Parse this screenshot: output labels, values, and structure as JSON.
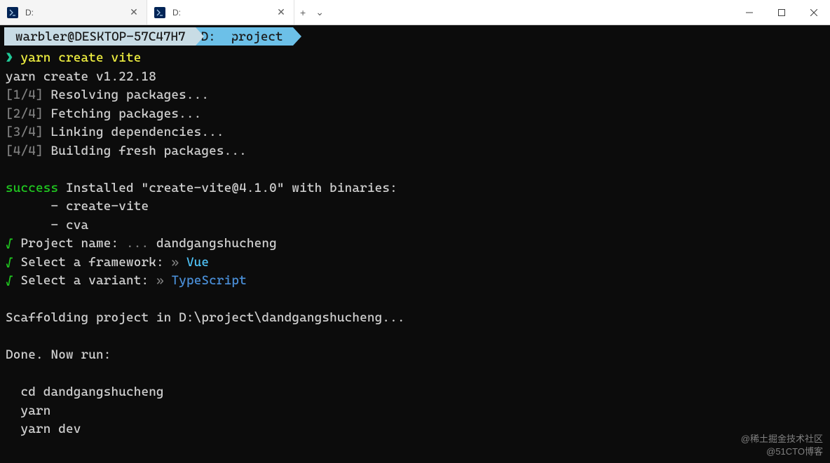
{
  "titlebar": {
    "tabs": [
      {
        "title": "D:",
        "active": false
      },
      {
        "title": "D:",
        "active": true
      }
    ],
    "new_tab": "+",
    "dropdown": "⌄"
  },
  "pathbar": {
    "user": "warbler@DESKTOP-57C47H7",
    "drive": "D:",
    "folder": "project"
  },
  "terminal": {
    "prompt_symbol": "❯",
    "command": "yarn create vite",
    "version_line": "yarn create v1.22.18",
    "steps": [
      {
        "num": "[1/4]",
        "text": "Resolving packages..."
      },
      {
        "num": "[2/4]",
        "text": "Fetching packages..."
      },
      {
        "num": "[3/4]",
        "text": "Linking dependencies..."
      },
      {
        "num": "[4/4]",
        "text": "Building fresh packages..."
      }
    ],
    "success_label": "success",
    "success_text": " Installed \"create-vite@4.1.0\" with binaries:",
    "binaries": [
      "      - create-vite",
      "      - cva"
    ],
    "project_name_check": "√",
    "project_name_label": " Project name:",
    "project_name_dots": " ... ",
    "project_name_value": "dandgangshucheng",
    "framework_check": "√",
    "framework_label": " Select a framework:",
    "framework_arrow": " » ",
    "framework_value": "Vue",
    "variant_check": "√",
    "variant_label": " Select a variant:",
    "variant_arrow": " » ",
    "variant_value": "TypeScript",
    "scaffolding": "Scaffolding project in D:\\project\\dandgangshucheng...",
    "done": "Done. Now run:",
    "run_cmds": [
      "  cd dandgangshucheng",
      "  yarn",
      "  yarn dev"
    ]
  },
  "watermark": {
    "line1": "@稀土掘金技术社区",
    "line2": "@51CTO博客"
  }
}
